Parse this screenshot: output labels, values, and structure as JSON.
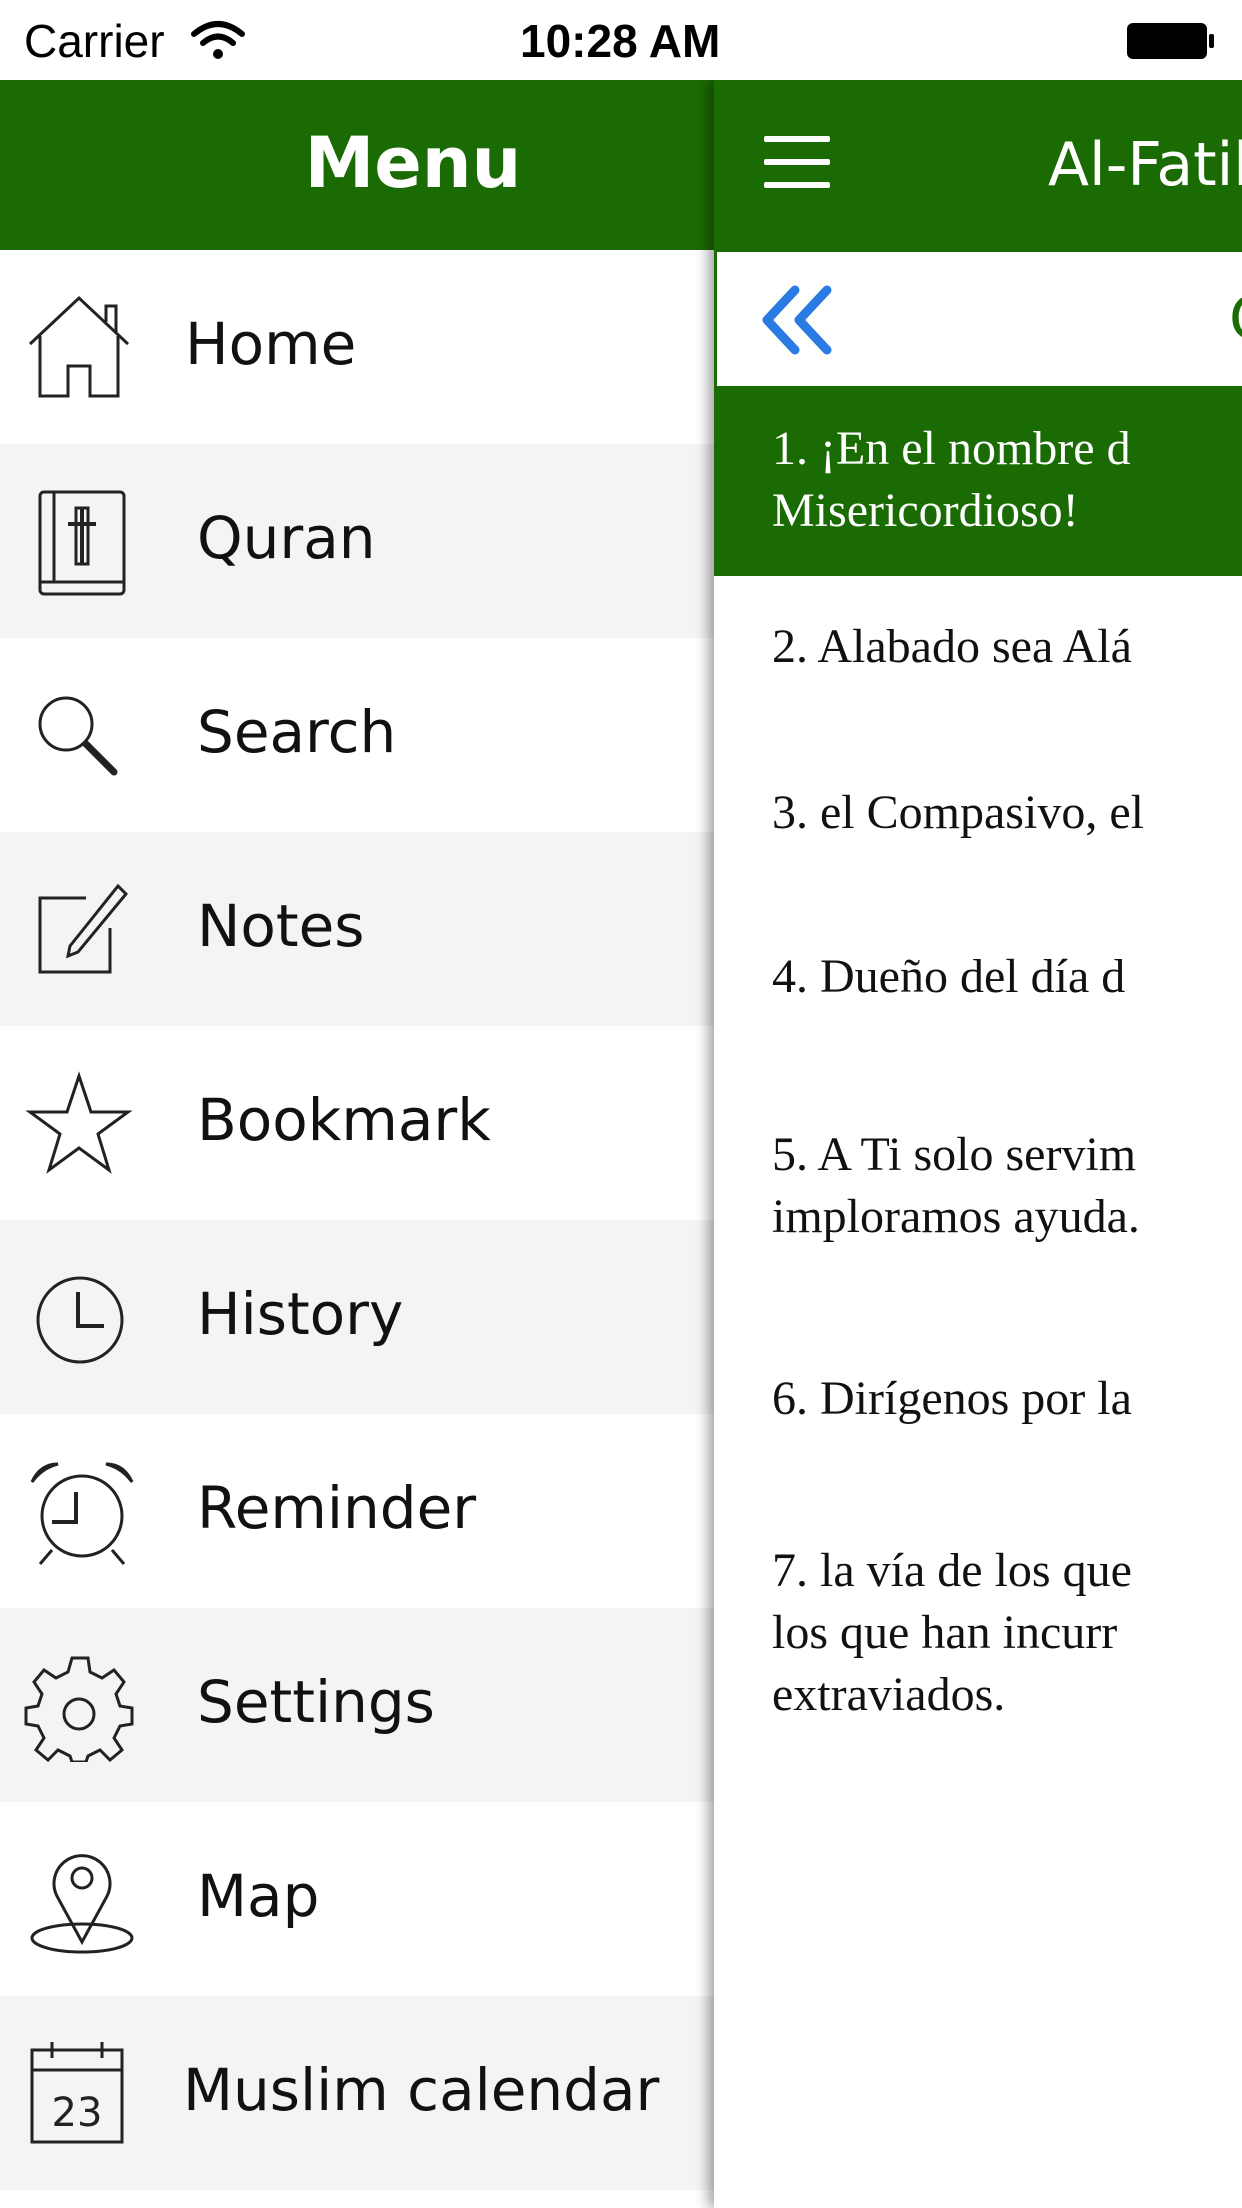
{
  "status_bar": {
    "carrier": "Carrier",
    "time": "10:28 AM"
  },
  "menu": {
    "title": "Menu",
    "items": [
      {
        "label": "Home",
        "icon": "home-icon"
      },
      {
        "label": "Quran",
        "icon": "book-icon"
      },
      {
        "label": "Search",
        "icon": "search-icon"
      },
      {
        "label": "Notes",
        "icon": "notes-icon"
      },
      {
        "label": "Bookmark",
        "icon": "star-icon"
      },
      {
        "label": "History",
        "icon": "clock-icon"
      },
      {
        "label": "Reminder",
        "icon": "alarm-icon"
      },
      {
        "label": "Settings",
        "icon": "gear-icon"
      },
      {
        "label": "Map",
        "icon": "map-pin-icon"
      },
      {
        "label": "Muslim calendar",
        "icon": "calendar-icon",
        "calendar_day": "23"
      }
    ]
  },
  "panel": {
    "title": "Al-Fatih",
    "subbar_partial": "C",
    "verses": [
      {
        "text": "1. ¡En el nombre d\nMisericordioso!"
      },
      {
        "text": "2. Alabado sea Alá"
      },
      {
        "text": "3. el Compasivo, el"
      },
      {
        "text": "4. Dueño del día d"
      },
      {
        "text": "5. A Ti solo servim\nimploramos ayuda."
      },
      {
        "text": "6. Dirígenos por la"
      },
      {
        "text": "7. la vía de los que\nlos que han incurr\nextraviados."
      }
    ]
  },
  "colors": {
    "header_green": "#1b6b04",
    "row_alt": "#f4f4f4",
    "link_blue": "#2a7be4"
  }
}
